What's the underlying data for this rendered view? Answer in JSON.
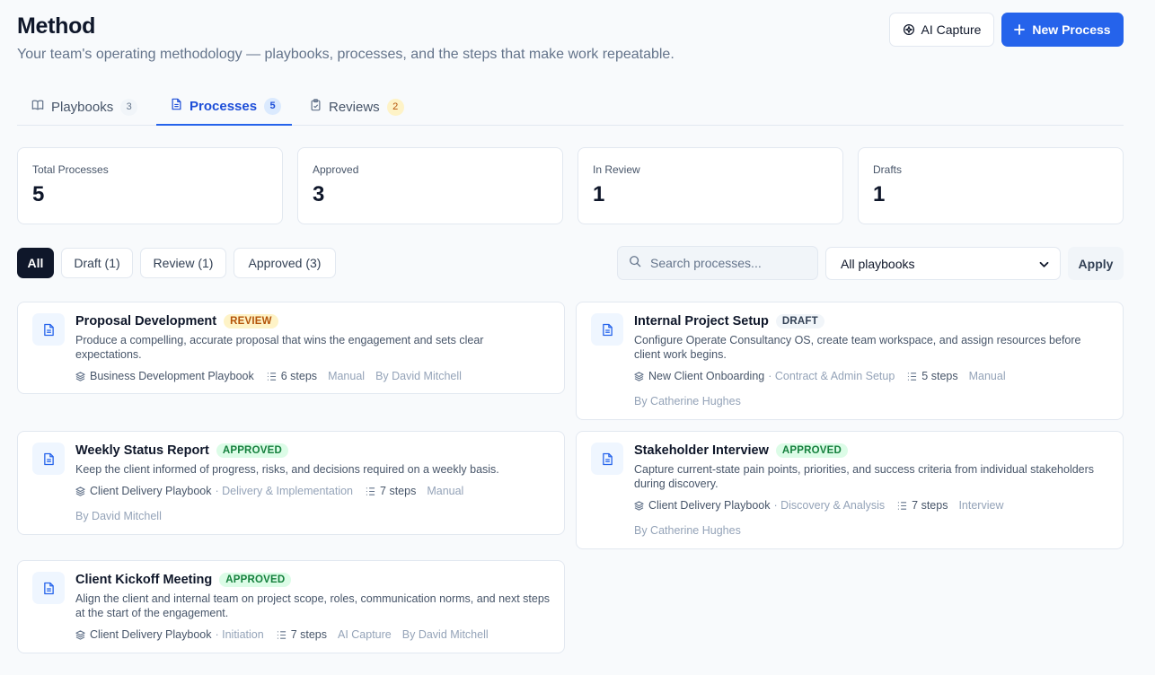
{
  "header": {
    "title": "Method",
    "subtitle": "Your team's operating methodology — playbooks, processes, and the steps that make work repeatable.",
    "ai_capture_label": "AI Capture",
    "new_process_label": "New Process"
  },
  "tabs": [
    {
      "label": "Playbooks",
      "count": "3",
      "active": false
    },
    {
      "label": "Processes",
      "count": "5",
      "active": true
    },
    {
      "label": "Reviews",
      "count": "2",
      "active": false
    }
  ],
  "stats": [
    {
      "label": "Total Processes",
      "value": "5"
    },
    {
      "label": "Approved",
      "value": "3"
    },
    {
      "label": "In Review",
      "value": "1"
    },
    {
      "label": "Drafts",
      "value": "1"
    }
  ],
  "filters": [
    {
      "label": "All",
      "active": true
    },
    {
      "label": "Draft (1)",
      "active": false
    },
    {
      "label": "Review (1)",
      "active": false
    },
    {
      "label": "Approved (3)",
      "active": false
    }
  ],
  "search": {
    "placeholder": "Search processes...",
    "value": ""
  },
  "playbook_select": {
    "value": "All playbooks"
  },
  "apply_label": "Apply",
  "colors": {
    "accent": "#2563eb",
    "review": "#b45309",
    "approved": "#15803d",
    "draft": "#334155"
  },
  "processes": [
    {
      "title": "Proposal Development",
      "status": "REVIEW",
      "description": "Produce a compelling, accurate proposal that wins the engagement and sets clear expectations.",
      "playbook": "Business Development Playbook",
      "section": "",
      "steps": "6 steps",
      "mode": "Manual",
      "author": "By David Mitchell"
    },
    {
      "title": "Internal Project Setup",
      "status": "DRAFT",
      "description": "Configure Operate Consultancy OS, create team workspace, and assign resources before client work begins.",
      "playbook": "New Client Onboarding",
      "section": "· Contract & Admin Setup",
      "steps": "5 steps",
      "mode": "Manual",
      "author": "By Catherine Hughes"
    },
    {
      "title": "Weekly Status Report",
      "status": "APPROVED",
      "description": "Keep the client informed of progress, risks, and decisions required on a weekly basis.",
      "playbook": "Client Delivery Playbook",
      "section": "· Delivery & Implementation",
      "steps": "7 steps",
      "mode": "Manual",
      "author": "By David Mitchell"
    },
    {
      "title": "Stakeholder Interview",
      "status": "APPROVED",
      "description": "Capture current-state pain points, priorities, and success criteria from individual stakeholders during discovery.",
      "playbook": "Client Delivery Playbook",
      "section": "· Discovery & Analysis",
      "steps": "7 steps",
      "mode": "Interview",
      "author": "By Catherine Hughes"
    },
    {
      "title": "Client Kickoff Meeting",
      "status": "APPROVED",
      "description": "Align the client and internal team on project scope, roles, communication norms, and next steps at the start of the engagement.",
      "playbook": "Client Delivery Playbook",
      "section": "· Initiation",
      "steps": "7 steps",
      "mode": "AI Capture",
      "author": "By David Mitchell"
    }
  ]
}
